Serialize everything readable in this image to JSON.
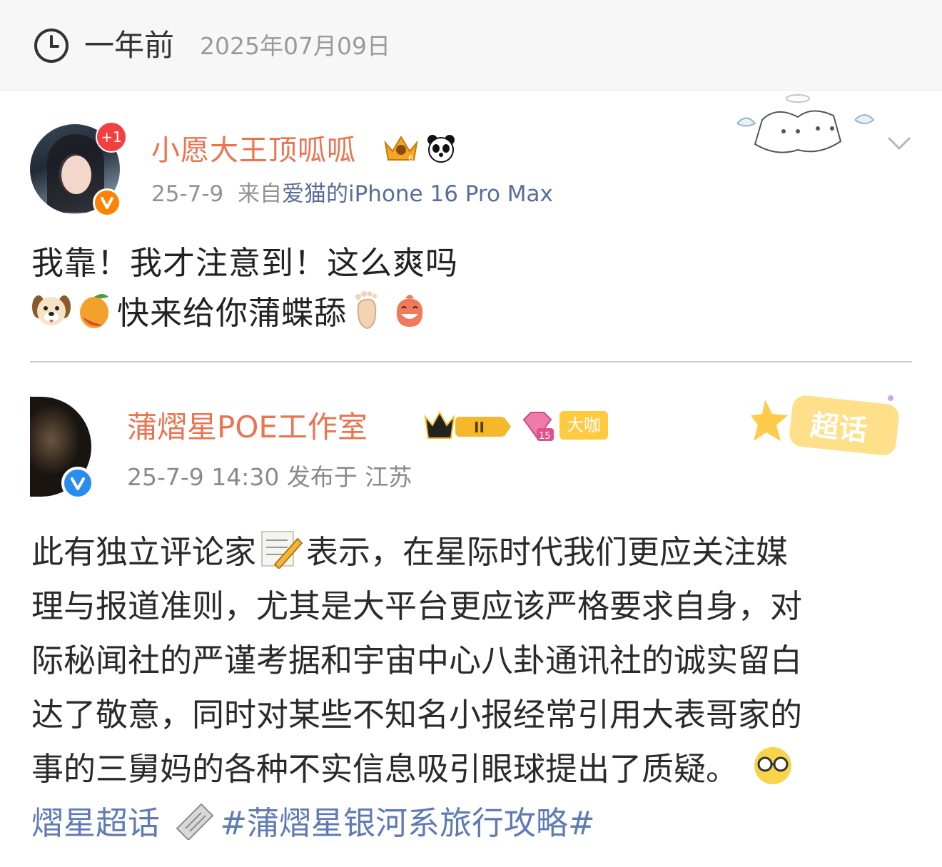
{
  "header": {
    "time_ago": "一年前",
    "full_date": "2025年07月09日"
  },
  "post": {
    "badge_count": "+1",
    "username": "小愿大王顶呱呱",
    "date": "25-7-9",
    "source_prefix": "来自",
    "source_device": "爱猫的iPhone 16 Pro Max",
    "line1": "我靠！我才注意到！这么爽吗",
    "line2_text": "快来给你蒲蝶舔"
  },
  "quoted": {
    "name": "蒲熠星POE工作室",
    "level_badge": "II",
    "diamond_level": "15",
    "daka_badge": "大咖",
    "meta": "25-7-9 14:30  发布于 江苏",
    "chaohua_label": "超话",
    "body": {
      "l1_a": "此有独立评论家",
      "l1_b": "表示，在星际时代我们更应关注媒",
      "l2": "理与报道准则，尤其是大平台更应该严格要求自身，对",
      "l3": "际秘闻社的严谨考据和宇宙中心八卦通讯社的诚实留白",
      "l4": "达了敬意，同时对某些不知名小报经常引用大表哥家的",
      "l5": "事的三舅妈的各种不实信息吸引眼球提出了质疑。",
      "l6_a": "熠星超话",
      "l6_b": "#蒲熠星银河系旅行攻略#"
    }
  },
  "icons": [
    "clock-icon",
    "crown-badge-icon",
    "panda-icon",
    "chevron-down-icon",
    "dog-emoji-icon",
    "mango-emoji-icon",
    "foot-emoji-icon",
    "grin-emoji-icon",
    "memo-emoji-icon",
    "newspaper-icon",
    "glasses-emoji-icon"
  ],
  "colors": {
    "username": "#eb7350",
    "verified_orange": "#ff8200",
    "verified_blue": "#2b8cf0",
    "link": "#5f7bb6",
    "source_link": "#5a6c9a"
  }
}
